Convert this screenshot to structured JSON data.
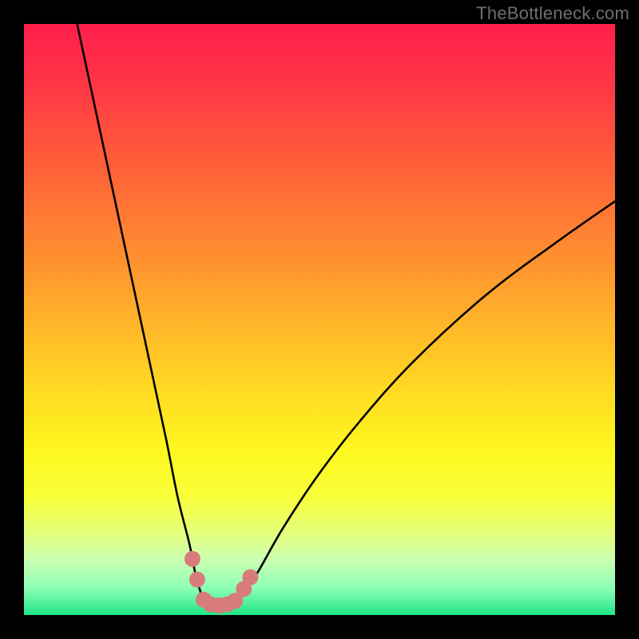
{
  "watermark": "TheBottleneck.com",
  "gradient_stops": [
    {
      "offset": 0,
      "color": "#ff1f4b"
    },
    {
      "offset": 0.1,
      "color": "#ff3546"
    },
    {
      "offset": 0.22,
      "color": "#ff5a3a"
    },
    {
      "offset": 0.36,
      "color": "#ff8432"
    },
    {
      "offset": 0.5,
      "color": "#ffb229"
    },
    {
      "offset": 0.62,
      "color": "#ffda22"
    },
    {
      "offset": 0.72,
      "color": "#fff71f"
    },
    {
      "offset": 0.8,
      "color": "#f8ff3a"
    },
    {
      "offset": 0.86,
      "color": "#e4ff7a"
    },
    {
      "offset": 0.905,
      "color": "#ccffb0"
    },
    {
      "offset": 0.955,
      "color": "#8cffb6"
    },
    {
      "offset": 1.0,
      "color": "#20e487"
    }
  ],
  "chart_data": {
    "type": "line",
    "title": "",
    "xlabel": "",
    "ylabel": "",
    "xlim": [
      0,
      100
    ],
    "ylim": [
      0,
      100
    ],
    "legend": false,
    "grid": false,
    "note": "Bottleneck percentage curve. The x-axis is component ratio (hidden); the y-axis is bottleneck percentage (100 = worst, 0 = none). The V shows low bottleneck near the balance point and higher away from it. Background color encodes severity (green=good, red=bad).",
    "series": [
      {
        "name": "bottleneck-curve",
        "x": [
          9,
          12,
          15,
          18,
          21,
          24,
          26,
          28,
          29,
          30,
          30.5,
          31,
          32,
          33,
          35,
          36,
          37.5,
          40,
          44,
          50,
          57,
          66,
          78,
          90,
          100
        ],
        "values": [
          100,
          86,
          72,
          58,
          44,
          30,
          20,
          12,
          7,
          3.5,
          2.2,
          1.8,
          1.6,
          1.6,
          1.9,
          2.4,
          4,
          8,
          15,
          24,
          33,
          43,
          54,
          63,
          70
        ]
      }
    ],
    "markers": {
      "name": "highlight-dots",
      "color": "#d87b7b",
      "radius_px": 10,
      "points": [
        {
          "x": 28.5,
          "y": 9.5
        },
        {
          "x": 29.3,
          "y": 6.0
        },
        {
          "x": 30.4,
          "y": 2.6
        },
        {
          "x": 31.6,
          "y": 1.8
        },
        {
          "x": 33.0,
          "y": 1.6
        },
        {
          "x": 34.4,
          "y": 1.8
        },
        {
          "x": 35.7,
          "y": 2.4
        },
        {
          "x": 37.2,
          "y": 4.4
        },
        {
          "x": 38.3,
          "y": 6.4
        }
      ]
    }
  }
}
